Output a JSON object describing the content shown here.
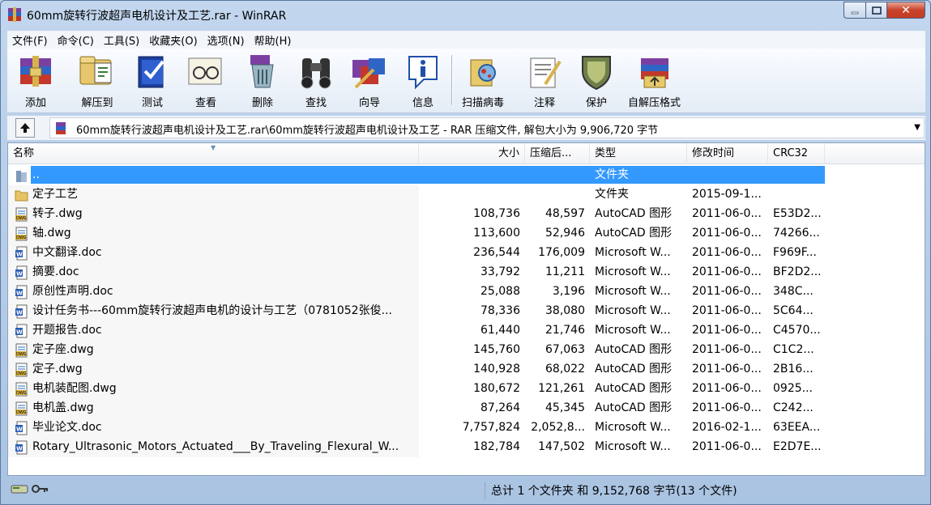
{
  "window": {
    "title": "60mm旋转行波超声电机设计及工艺.rar - WinRAR",
    "icon": "winrar-books-icon"
  },
  "menu": [
    "文件(F)",
    "命令(C)",
    "工具(S)",
    "收藏夹(O)",
    "选项(N)",
    "帮助(H)"
  ],
  "toolbar": [
    {
      "label": "添加",
      "icon": "add-archive-icon"
    },
    {
      "label": "解压到",
      "icon": "extract-to-icon"
    },
    {
      "label": "测试",
      "icon": "test-icon"
    },
    {
      "label": "查看",
      "icon": "view-icon"
    },
    {
      "label": "删除",
      "icon": "delete-icon"
    },
    {
      "label": "查找",
      "icon": "find-binoculars-icon"
    },
    {
      "label": "向导",
      "icon": "wizard-icon"
    },
    {
      "label": "信息",
      "icon": "info-icon"
    },
    {
      "label": "扫描病毒",
      "icon": "virus-scan-icon"
    },
    {
      "label": "注释",
      "icon": "comment-icon"
    },
    {
      "label": "保护",
      "icon": "protect-shield-icon"
    },
    {
      "label": "自解压格式",
      "icon": "sfx-icon"
    }
  ],
  "address": {
    "text": "60mm旋转行波超声电机设计及工艺.rar\\60mm旋转行波超声电机设计及工艺 - RAR 压缩文件, 解包大小为 9,906,720 字节"
  },
  "columns": {
    "name": "名称",
    "size": "大小",
    "packed": "压缩后...",
    "type": "类型",
    "modified": "修改时间",
    "crc": "CRC32"
  },
  "files": [
    {
      "name": "..",
      "size": "",
      "packed": "",
      "type": "文件夹",
      "modified": "",
      "crc": "",
      "icon": "parent-folder-icon",
      "selected": true
    },
    {
      "name": "定子工艺",
      "size": "",
      "packed": "",
      "type": "文件夹",
      "modified": "2015-09-1...",
      "crc": "",
      "icon": "folder-icon"
    },
    {
      "name": "转子.dwg",
      "size": "108,736",
      "packed": "48,597",
      "type": "AutoCAD 图形",
      "modified": "2011-06-0...",
      "crc": "E53D2...",
      "icon": "dwg-file-icon"
    },
    {
      "name": "轴.dwg",
      "size": "113,600",
      "packed": "52,946",
      "type": "AutoCAD 图形",
      "modified": "2011-06-0...",
      "crc": "74266...",
      "icon": "dwg-file-icon"
    },
    {
      "name": "中文翻译.doc",
      "size": "236,544",
      "packed": "176,009",
      "type": "Microsoft W...",
      "modified": "2011-06-0...",
      "crc": "F969F...",
      "icon": "word-doc-icon"
    },
    {
      "name": "摘要.doc",
      "size": "33,792",
      "packed": "11,211",
      "type": "Microsoft W...",
      "modified": "2011-06-0...",
      "crc": "BF2D2...",
      "icon": "word-doc-icon"
    },
    {
      "name": "原创性声明.doc",
      "size": "25,088",
      "packed": "3,196",
      "type": "Microsoft W...",
      "modified": "2011-06-0...",
      "crc": "348C...",
      "icon": "word-doc-icon"
    },
    {
      "name": "设计任务书---60mm旋转行波超声电机的设计与工艺（0781052张俊...",
      "size": "78,336",
      "packed": "38,080",
      "type": "Microsoft W...",
      "modified": "2011-06-0...",
      "crc": "5C64...",
      "icon": "word-doc-icon"
    },
    {
      "name": "开题报告.doc",
      "size": "61,440",
      "packed": "21,746",
      "type": "Microsoft W...",
      "modified": "2011-06-0...",
      "crc": "C4570...",
      "icon": "word-doc-icon"
    },
    {
      "name": "定子座.dwg",
      "size": "145,760",
      "packed": "67,063",
      "type": "AutoCAD 图形",
      "modified": "2011-06-0...",
      "crc": "C1C2...",
      "icon": "dwg-file-icon"
    },
    {
      "name": "定子.dwg",
      "size": "140,928",
      "packed": "68,022",
      "type": "AutoCAD 图形",
      "modified": "2011-06-0...",
      "crc": "2B16...",
      "icon": "dwg-file-icon"
    },
    {
      "name": "电机装配图.dwg",
      "size": "180,672",
      "packed": "121,261",
      "type": "AutoCAD 图形",
      "modified": "2011-06-0...",
      "crc": "0925...",
      "icon": "dwg-file-icon"
    },
    {
      "name": "电机盖.dwg",
      "size": "87,264",
      "packed": "45,345",
      "type": "AutoCAD 图形",
      "modified": "2011-06-0...",
      "crc": "C242...",
      "icon": "dwg-file-icon"
    },
    {
      "name": "毕业论文.doc",
      "size": "7,757,824",
      "packed": "2,052,8...",
      "type": "Microsoft W...",
      "modified": "2016-02-1...",
      "crc": "63EEA...",
      "icon": "word-doc-icon"
    },
    {
      "name": "Rotary_Ultrasonic_Motors_Actuated___By_Traveling_Flexural_W...",
      "size": "182,784",
      "packed": "147,502",
      "type": "Microsoft W...",
      "modified": "2011-06-0...",
      "crc": "E2D7E...",
      "icon": "word-doc-icon"
    }
  ],
  "status": {
    "text": "总计 1 个文件夹 和 9,152,768 字节(13 个文件)"
  },
  "colors": {
    "selection": "#3399ff",
    "frame": "#b9d1ea"
  }
}
